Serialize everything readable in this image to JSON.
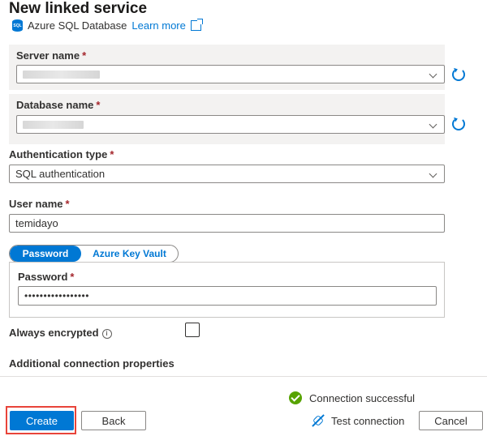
{
  "header": {
    "title": "New linked service",
    "service_icon": "sql-database-icon",
    "service_name": "Azure SQL Database",
    "learn_more": "Learn more",
    "external_icon": "external-link-icon"
  },
  "form": {
    "server_name": {
      "label": "Server name",
      "required": "*",
      "value": ""
    },
    "database_name": {
      "label": "Database name",
      "required": "*",
      "value": ""
    },
    "auth_type": {
      "label": "Authentication type",
      "required": "*",
      "value": "SQL authentication"
    },
    "user_name": {
      "label": "User name",
      "required": "*",
      "value": "temidayo"
    },
    "password_toggle": {
      "option_password": "Password",
      "option_key_vault": "Azure Key Vault",
      "selected": "Password"
    },
    "password": {
      "label": "Password",
      "required": "*",
      "value": "•••••••••••••••••"
    },
    "always_encrypted": {
      "label": "Always encrypted",
      "info_glyph": "i",
      "checked": false
    },
    "additional_properties": {
      "label": "Additional connection properties"
    }
  },
  "footer": {
    "connection_status": "Connection successful",
    "create_label": "Create",
    "back_label": "Back",
    "test_connection_label": "Test connection",
    "cancel_label": "Cancel"
  },
  "colors": {
    "accent": "#0078d4",
    "success": "#57a300",
    "required": "#a4262c",
    "highlight_box": "#e8443a"
  }
}
